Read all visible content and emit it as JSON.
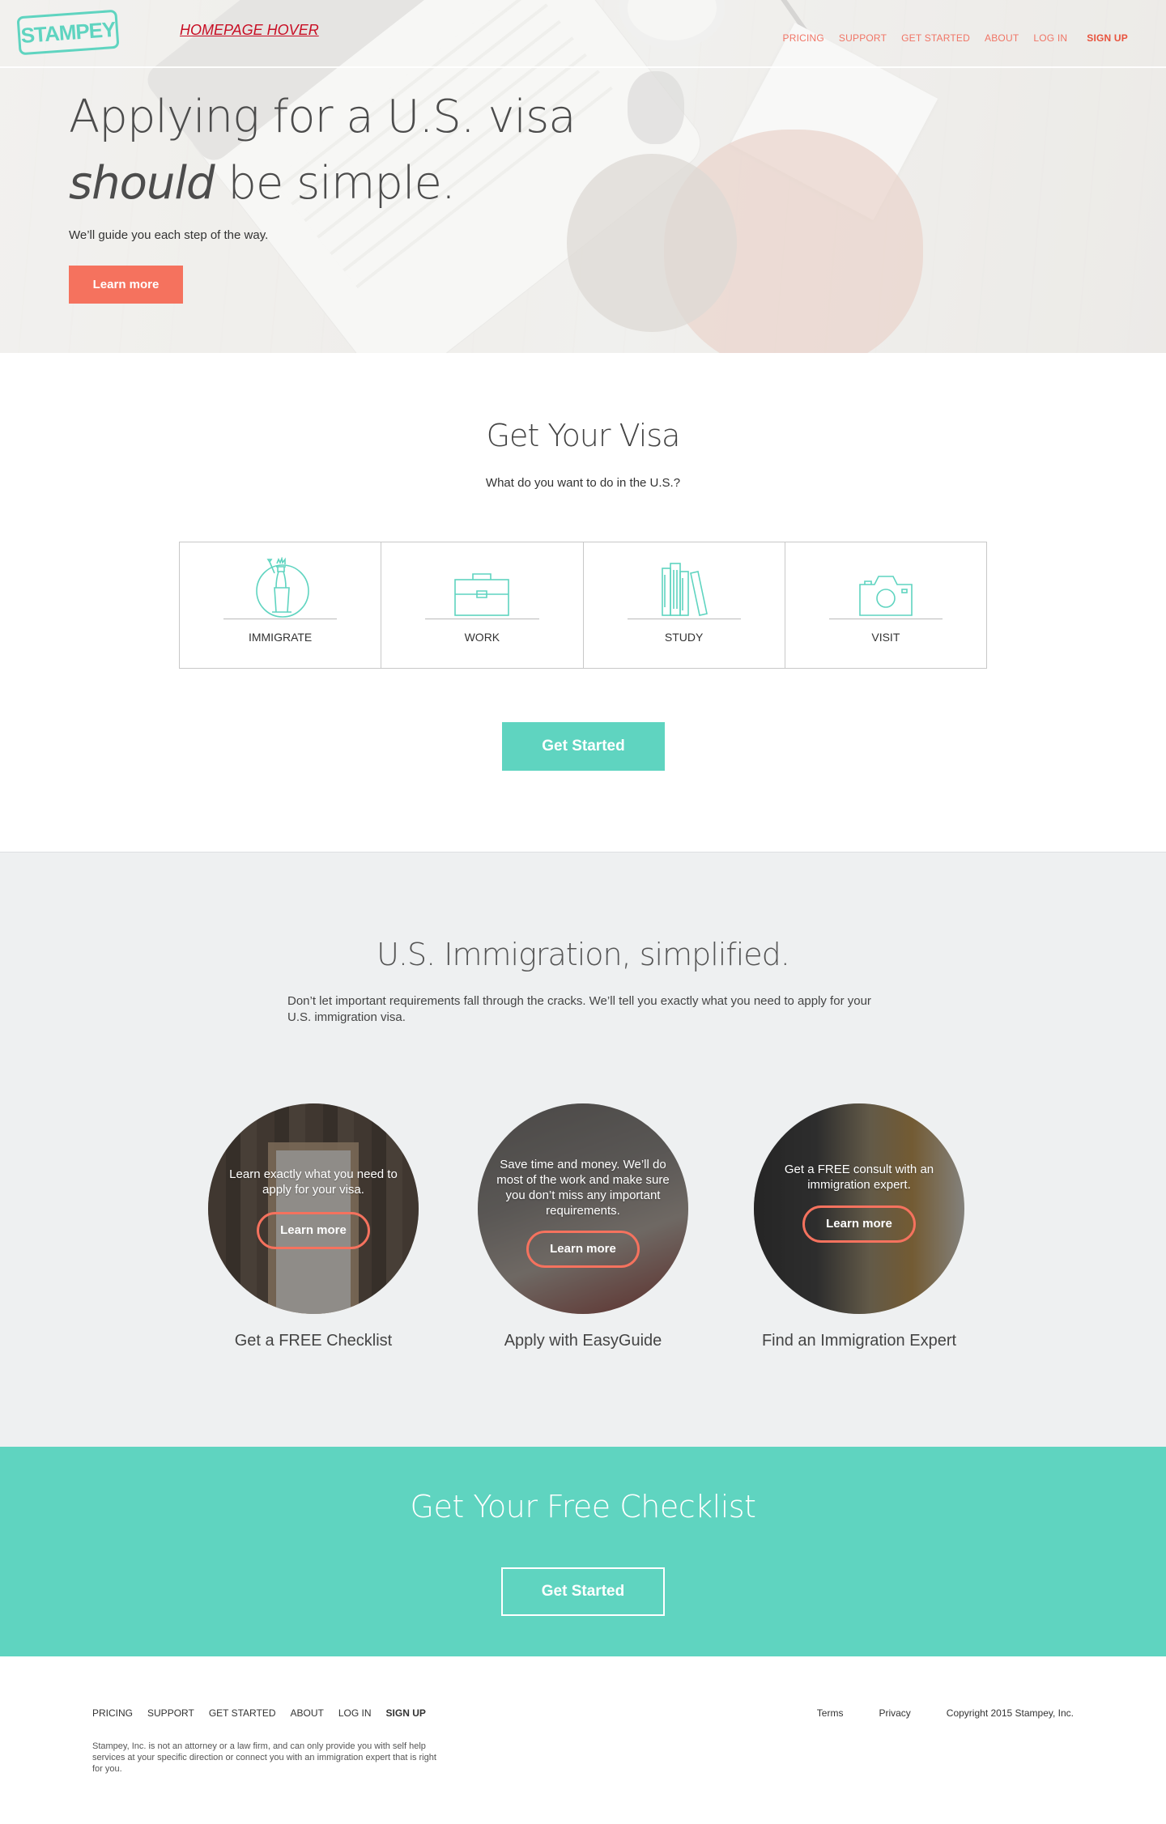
{
  "nav": {
    "logo": "STAMPEY",
    "hover_label": "HOMEPAGE HOVER",
    "links": [
      "PRICING",
      "SUPPORT",
      "GET STARTED",
      "ABOUT",
      "LOG IN"
    ],
    "signup": "SIGN UP"
  },
  "hero": {
    "title_line1": "Applying for a U.S. visa",
    "title_em": "should",
    "title_rest": " be simple.",
    "subtitle": "We’ll guide you each step of the way.",
    "cta": "Learn more"
  },
  "visa": {
    "title": "Get Your Visa",
    "question": "What do you want to do in the U.S.?",
    "options": [
      {
        "label": "IMMIGRATE",
        "icon": "statue-of-liberty-icon"
      },
      {
        "label": "WORK",
        "icon": "briefcase-icon"
      },
      {
        "label": "STUDY",
        "icon": "books-icon"
      },
      {
        "label": "VISIT",
        "icon": "camera-icon"
      }
    ],
    "cta": "Get Started"
  },
  "simplified": {
    "title": "U.S. Immigration, simplified.",
    "description": "Don’t let important requirements fall through the cracks.  We’ll tell you exactly what you need to apply for your U.S. immigration visa.",
    "features": [
      {
        "overlay": "Learn exactly what you need to apply for your visa.",
        "button": "Learn more",
        "title": "Get a FREE Checklist"
      },
      {
        "overlay": "Save time and money.  We’ll do most of the work and make sure you don’t miss any important requirements.",
        "button": "Learn more",
        "title": "Apply with EasyGuide"
      },
      {
        "overlay": "Get a FREE consult with an immigration expert.",
        "button": "Learn more",
        "title": "Find an Immigration Expert"
      }
    ]
  },
  "checklist": {
    "title": "Get Your Free Checklist",
    "cta": "Get Started"
  },
  "footer": {
    "links": [
      "PRICING",
      "SUPPORT",
      "GET STARTED",
      "ABOUT",
      "LOG IN"
    ],
    "signup": "SIGN UP",
    "terms": "Terms",
    "privacy": "Privacy",
    "copyright": "Copyright 2015 Stampey, Inc.",
    "disclaimer": "Stampey, Inc. is not an attorney or a law firm, and can only provide you with self help services at your specific direction or connect you with an immigration expert that is right for you."
  },
  "colors": {
    "teal": "#5fd4c0",
    "coral": "#f5725e",
    "hover_label": "#c80e24",
    "section_gray": "#eef0f1"
  }
}
